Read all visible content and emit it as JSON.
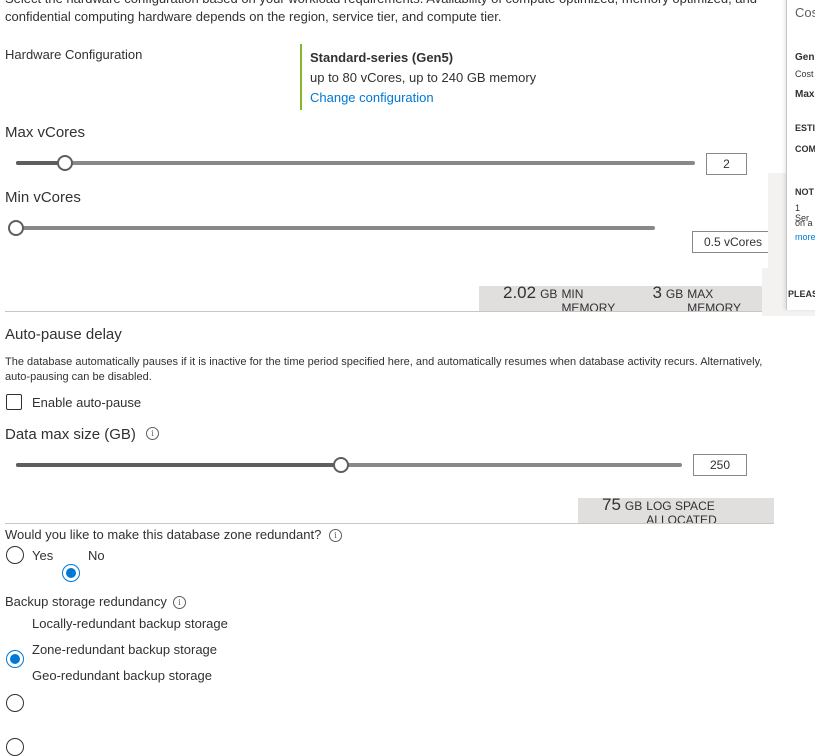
{
  "intro": {
    "line1": "Select the hardware configuration based on your workload requirements. Availability of compute optimized, memory optimized, and",
    "line2": "confidential computing hardware depends on the region, service tier, and compute tier."
  },
  "hardware": {
    "label": "Hardware Configuration",
    "title": "Standard-series (Gen5)",
    "description": "up to 80 vCores, up to 240 GB memory",
    "change_link": "Change configuration",
    "accent_color": "#84b82b"
  },
  "max_vcores": {
    "label": "Max vCores",
    "value": "2",
    "slider_fraction": 0.07
  },
  "min_vcores": {
    "label": "Min vCores",
    "value": "0.5 vCores",
    "slider_fraction": 0.0
  },
  "memory": {
    "min_value": "2.02",
    "min_unit": "GB",
    "min_caption": "MIN MEMORY",
    "max_value": "3",
    "max_unit": "GB",
    "max_caption": "MAX MEMORY"
  },
  "auto_pause": {
    "heading": "Auto-pause delay",
    "description_line1": "The database automatically pauses if it is inactive for the time period specified here, and automatically resumes when database activity recurs. Alternatively,",
    "description_line2": "auto-pausing can be disabled.",
    "checkbox_label": "Enable auto-pause",
    "checked": false
  },
  "data_max_size": {
    "label": "Data max size (GB)",
    "value": "250",
    "slider_fraction": 0.485
  },
  "log_space": {
    "value": "75",
    "unit": "GB",
    "caption": "LOG SPACE ALLOCATED"
  },
  "zone_redundant": {
    "question": "Would you like to make this database zone redundant?",
    "options": [
      "Yes",
      "No"
    ],
    "selected": "No"
  },
  "backup": {
    "label": "Backup storage redundancy",
    "options": [
      "Locally-redundant backup storage",
      "Zone-redundant backup storage",
      "Geo-redundant backup storage"
    ],
    "selected": "Locally-redundant backup storage"
  },
  "side_panel": {
    "t1": "Cos",
    "t2": "Gen",
    "t3": "Cost",
    "t4": "Max",
    "t5": "ESTI",
    "t6": "COM",
    "t7": "NOT",
    "t8": "1 Ser",
    "t9": "on a",
    "t10": "more",
    "t11": "PLEAS"
  },
  "colors": {
    "accent": "#0078d4",
    "info_bar": "#e1dfdd"
  },
  "icons": {
    "info": "info-icon"
  }
}
